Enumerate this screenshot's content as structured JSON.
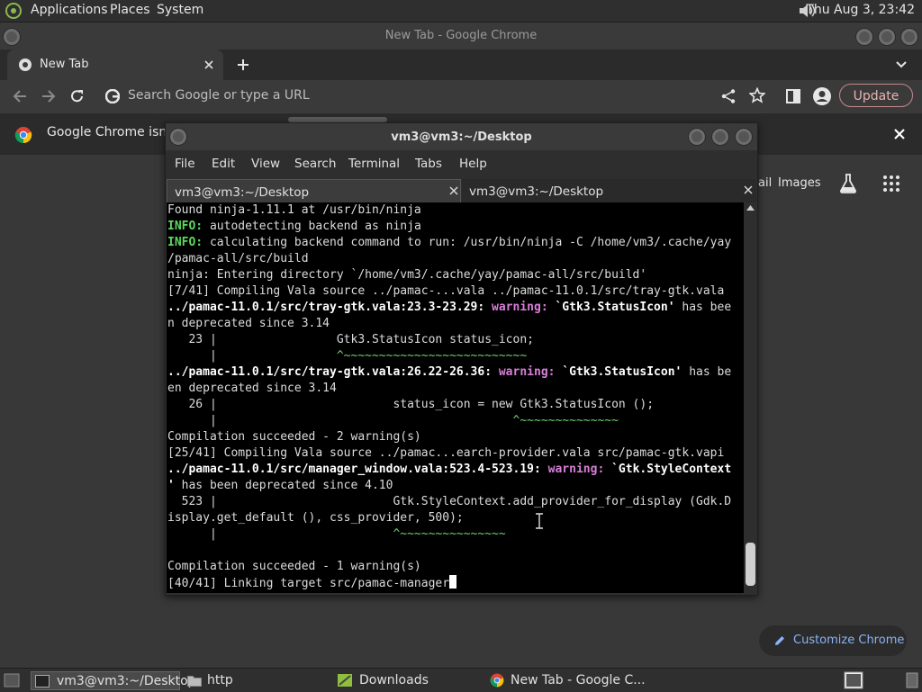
{
  "top_panel": {
    "menus": [
      "Applications",
      "Places",
      "System"
    ],
    "clock": "Thu Aug  3, 23:42",
    "icons": [
      "gnome-foot-icon",
      "volume-icon"
    ]
  },
  "chrome": {
    "window_title": "New Tab - Google Chrome",
    "tab_title": "New Tab",
    "omnibox_placeholder": "Search Google or type a URL",
    "update_label": "Update",
    "infobar_text": "Google Chrome isn't",
    "ntp_links": [
      "ail",
      "Images"
    ],
    "customize_label": "Customize Chrome"
  },
  "terminal": {
    "window_title": "vm3@vm3:~/Desktop",
    "menus": [
      "File",
      "Edit",
      "View",
      "Search",
      "Terminal",
      "Tabs",
      "Help"
    ],
    "tabs": [
      "vm3@vm3:~/Desktop",
      "vm3@vm3:~/Desktop"
    ],
    "lines": [
      {
        "segments": [
          {
            "t": "Found ninja-1.11.1 at /usr/bin/ninja",
            "s": ""
          }
        ]
      },
      {
        "segments": [
          {
            "t": "INFO:",
            "s": "ok"
          },
          {
            "t": " autodetecting backend as ninja",
            "s": ""
          }
        ]
      },
      {
        "segments": [
          {
            "t": "INFO:",
            "s": "ok"
          },
          {
            "t": " calculating backend command to run: /usr/bin/ninja -C /home/vm3/.cache/yay",
            "s": ""
          }
        ]
      },
      {
        "segments": [
          {
            "t": "/pamac-all/src/build",
            "s": ""
          }
        ]
      },
      {
        "segments": [
          {
            "t": "ninja: Entering directory `/home/vm3/.cache/yay/pamac-all/src/build'",
            "s": ""
          }
        ]
      },
      {
        "segments": [
          {
            "t": "[7/41] Compiling Vala source ../pamac-...vala ../pamac-11.0.1/src/tray-gtk.vala",
            "s": ""
          }
        ]
      },
      {
        "segments": [
          {
            "t": "../pamac-11.0.1/src/tray-gtk.vala:23.3-23.29:",
            "s": "b"
          },
          {
            "t": " ",
            "s": ""
          },
          {
            "t": "warning:",
            "s": "w"
          },
          {
            "t": " ",
            "s": ""
          },
          {
            "t": "`Gtk3.StatusIcon'",
            "s": "b"
          },
          {
            "t": " has bee",
            "s": ""
          }
        ]
      },
      {
        "segments": [
          {
            "t": "n deprecated since 3.14",
            "s": ""
          }
        ]
      },
      {
        "segments": [
          {
            "t": "   23 |                 Gtk3.StatusIcon status_icon;",
            "s": ""
          }
        ]
      },
      {
        "segments": [
          {
            "t": "      |                 ",
            "s": ""
          },
          {
            "t": "^~~~~~~~~~~~~~~~~~~~~~~~~~~",
            "s": "g"
          }
        ]
      },
      {
        "segments": [
          {
            "t": "../pamac-11.0.1/src/tray-gtk.vala:26.22-26.36:",
            "s": "b"
          },
          {
            "t": " ",
            "s": ""
          },
          {
            "t": "warning:",
            "s": "w"
          },
          {
            "t": " ",
            "s": ""
          },
          {
            "t": "`Gtk3.StatusIcon'",
            "s": "b"
          },
          {
            "t": " has be",
            "s": ""
          }
        ]
      },
      {
        "segments": [
          {
            "t": "en deprecated since 3.14",
            "s": ""
          }
        ]
      },
      {
        "segments": [
          {
            "t": "   26 |                         status_icon = new Gtk3.StatusIcon ();",
            "s": ""
          }
        ]
      },
      {
        "segments": [
          {
            "t": "      |                                          ",
            "s": ""
          },
          {
            "t": "^~~~~~~~~~~~~~~",
            "s": "g"
          }
        ]
      },
      {
        "segments": [
          {
            "t": "Compilation succeeded - 2 warning(s)",
            "s": ""
          }
        ]
      },
      {
        "segments": [
          {
            "t": "[25/41] Compiling Vala source ../pamac...earch-provider.vala src/pamac-gtk.vapi",
            "s": ""
          }
        ]
      },
      {
        "segments": [
          {
            "t": "../pamac-11.0.1/src/manager_window.vala:523.4-523.19:",
            "s": "b"
          },
          {
            "t": " ",
            "s": ""
          },
          {
            "t": "warning:",
            "s": "w"
          },
          {
            "t": " ",
            "s": ""
          },
          {
            "t": "`Gtk.StyleContext",
            "s": "b"
          }
        ]
      },
      {
        "segments": [
          {
            "t": "'",
            "s": "b"
          },
          {
            "t": " has been deprecated since 4.10",
            "s": ""
          }
        ]
      },
      {
        "segments": [
          {
            "t": "  523 |                         Gtk.StyleContext.add_provider_for_display (Gdk.D",
            "s": ""
          }
        ]
      },
      {
        "segments": [
          {
            "t": "isplay.get_default (), css_provider, 500);",
            "s": ""
          }
        ]
      },
      {
        "segments": [
          {
            "t": "      |                         ",
            "s": ""
          },
          {
            "t": "^~~~~~~~~~~~~~~~",
            "s": "g"
          }
        ]
      },
      {
        "segments": [
          {
            "t": "",
            "s": ""
          }
        ]
      },
      {
        "segments": [
          {
            "t": "Compilation succeeded - 1 warning(s)",
            "s": ""
          }
        ]
      },
      {
        "segments": [
          {
            "t": "[40/41] Linking target src/pamac-manager",
            "s": ""
          }
        ]
      }
    ]
  },
  "taskbar": {
    "items": [
      "vm3@vm3:~/Desktop",
      "http",
      "Downloads",
      "New Tab - Google C..."
    ]
  },
  "colors": {
    "info_green": "#5fd75f",
    "warning_magenta": "#d77fd7",
    "caret_green": "#6fd36f",
    "update_border": "#c58a8a",
    "customize_blue": "#8ab4f8"
  }
}
